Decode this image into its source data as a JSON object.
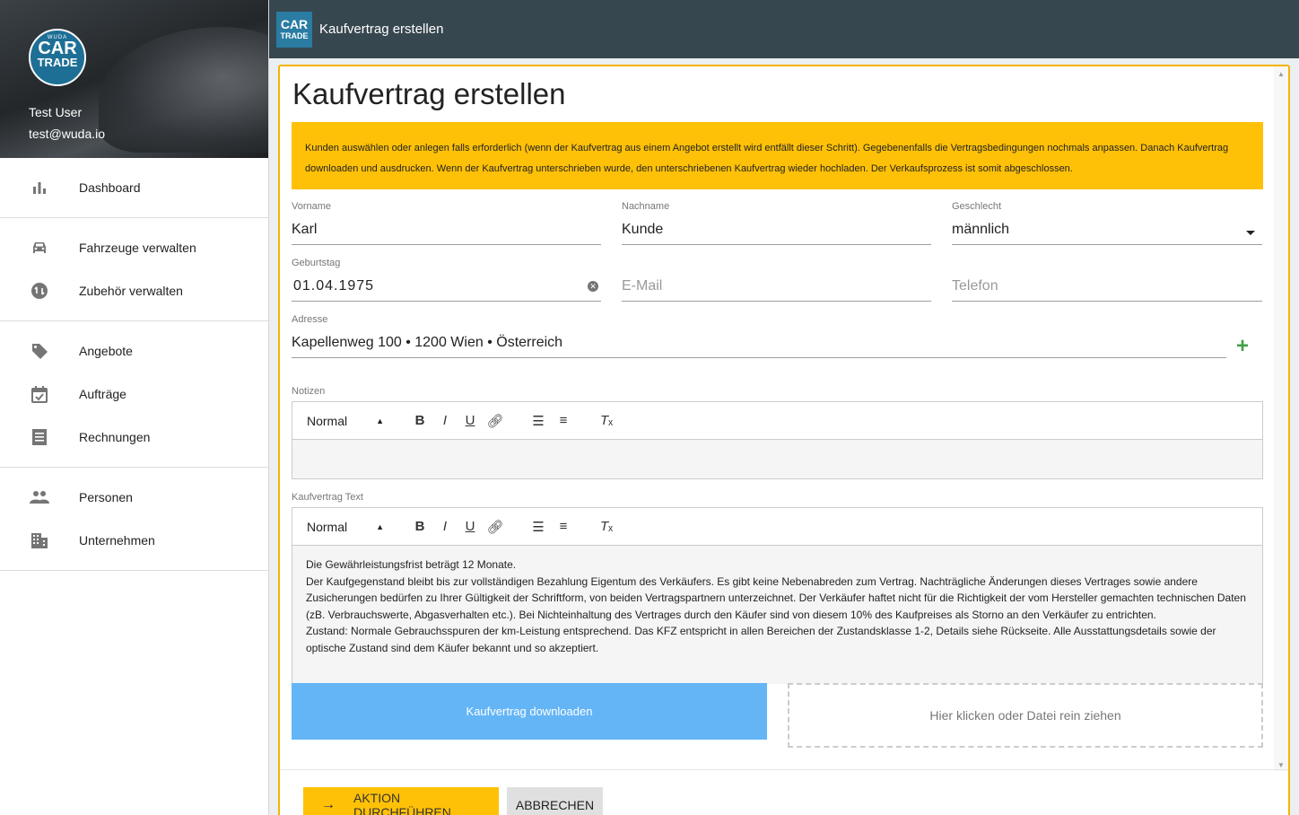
{
  "sidebar": {
    "logo": {
      "line1": "WUDA",
      "line2": "CAR",
      "line3": "TRADE"
    },
    "user_name": "Test User",
    "user_email": "test@wuda.io",
    "groups": [
      [
        {
          "label": "Dashboard",
          "icon": "bar-chart-icon"
        }
      ],
      [
        {
          "label": "Fahrzeuge verwalten",
          "icon": "car-icon"
        },
        {
          "label": "Zubehör verwalten",
          "icon": "accessory-icon"
        }
      ],
      [
        {
          "label": "Angebote",
          "icon": "tag-icon"
        },
        {
          "label": "Aufträge",
          "icon": "calendar-check-icon"
        },
        {
          "label": "Rechnungen",
          "icon": "receipt-icon"
        }
      ],
      [
        {
          "label": "Personen",
          "icon": "people-icon"
        },
        {
          "label": "Unternehmen",
          "icon": "building-icon"
        }
      ]
    ]
  },
  "topbar": {
    "logo_a": "CAR",
    "logo_b": "TRADE",
    "title": "Kaufvertrag erstellen"
  },
  "main": {
    "title": "Kaufvertrag erstellen",
    "info": "Kunden auswählen oder anlegen falls erforderlich (wenn der Kaufvertrag aus einem Angebot erstellt wird entfällt dieser Schritt). Gegebenenfalls die Vertragsbedingungen nochmals anpassen. Danach Kaufvertrag downloaden und ausdrucken. Wenn der Kaufvertrag unterschrieben wurde, den unterschriebenen Kaufvertrag wieder hochladen. Der Verkaufsprozess ist somit abgeschlossen.",
    "fields": {
      "vorname": {
        "label": "Vorname",
        "value": "Karl"
      },
      "nachname": {
        "label": "Nachname",
        "value": "Kunde"
      },
      "geschlecht": {
        "label": "Geschlecht",
        "value": "männlich"
      },
      "geburtstag": {
        "label": "Geburtstag",
        "value": "01.04.1975"
      },
      "email": {
        "placeholder": "E-Mail"
      },
      "telefon": {
        "placeholder": "Telefon"
      },
      "adresse": {
        "label": "Adresse",
        "value": "Kapellenweg 100 • 1200 Wien • Österreich"
      }
    },
    "notizen": {
      "label": "Notizen",
      "format": "Normal",
      "content": ""
    },
    "kaufvertrag": {
      "label": "Kaufvertrag Text",
      "format": "Normal",
      "paragraphs": [
        "Die Gewährleistungsfrist beträgt 12 Monate.",
        "Der Kaufgegenstand bleibt bis zur vollständigen Bezahlung Eigentum des Verkäufers. Es gibt keine Nebenabreden zum Vertrag. Nachträgliche Änderungen dieses Vertrages sowie andere Zusicherungen bedürfen zu Ihrer Gültigkeit der Schriftform, von beiden Vertragspartnern unterzeichnet. Der Verkäufer haftet nicht für die Richtigkeit der vom Hersteller gemachten technischen Daten (zB. Verbrauchswerte, Abgasverhalten etc.). Bei Nichteinhaltung des Vertrages durch den Käufer sind von diesem 10% des Kaufpreises als Storno an den Verkäufer zu entrichten.",
        "Zustand: Normale Gebrauchsspuren der km-Leistung entsprechend. Das KFZ entspricht in allen Bereichen der Zustandsklasse 1-2, Details siehe Rückseite. Alle Ausstattungsdetails sowie der optische Zustand sind dem Käufer bekannt und so akzeptiert."
      ]
    },
    "download_label": "Kaufvertrag downloaden",
    "dropzone_label": "Hier klicken oder Datei rein ziehen",
    "action_label": "AKTION DURCHFÜHREN",
    "cancel_label": "ABBRECHEN"
  },
  "colors": {
    "topbar": "#37474f",
    "accent": "#ffc107",
    "download": "#64b5f6",
    "add": "#43a047"
  }
}
